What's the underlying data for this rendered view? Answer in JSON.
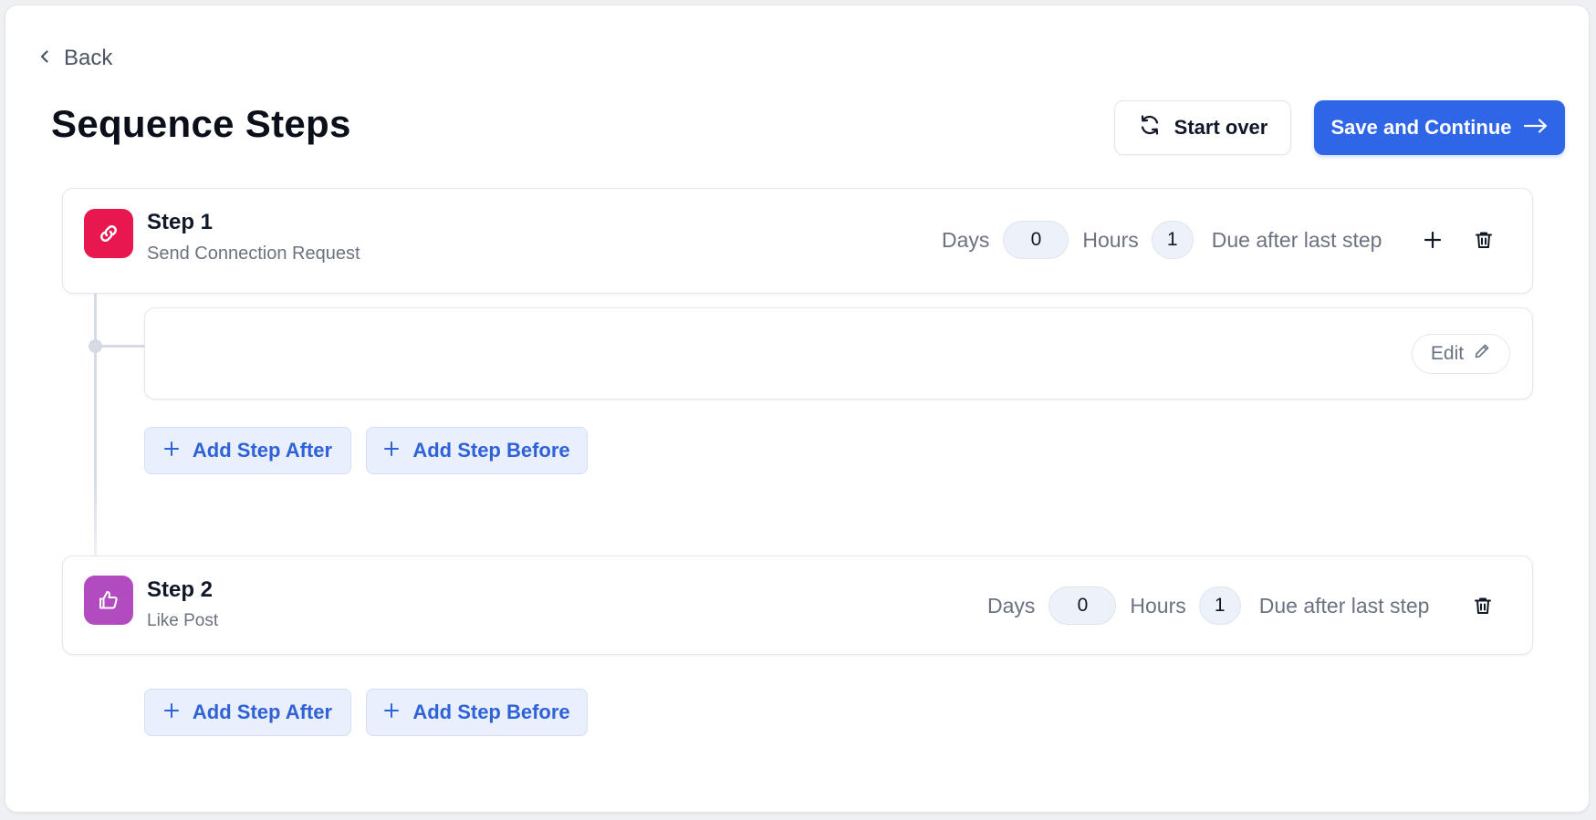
{
  "nav": {
    "back_label": "Back"
  },
  "page": {
    "title": "Sequence Steps"
  },
  "actions": {
    "start_over_label": "Start over",
    "save_continue_label": "Save and Continue"
  },
  "steps": [
    {
      "title": "Step 1",
      "subtitle": "Send Connection Request",
      "icon": "link-icon",
      "icon_color": "#e8174f",
      "days_label": "Days",
      "days_value": "0",
      "hours_label": "Hours",
      "hours_value": "1",
      "due_label": "Due after last step",
      "edit_label": "Edit",
      "add_after_label": "Add Step After",
      "add_before_label": "Add Step Before"
    },
    {
      "title": "Step 2",
      "subtitle": "Like Post",
      "icon": "thumbs-up-icon",
      "icon_color": "#b14bbf",
      "days_label": "Days",
      "days_value": "0",
      "hours_label": "Hours",
      "hours_value": "1",
      "due_label": "Due after last step",
      "add_after_label": "Add Step After",
      "add_before_label": "Add Step Before"
    }
  ],
  "colors": {
    "primary": "#2f66e8",
    "add_button_bg": "#e9effc",
    "add_button_text": "#2f62d6"
  }
}
